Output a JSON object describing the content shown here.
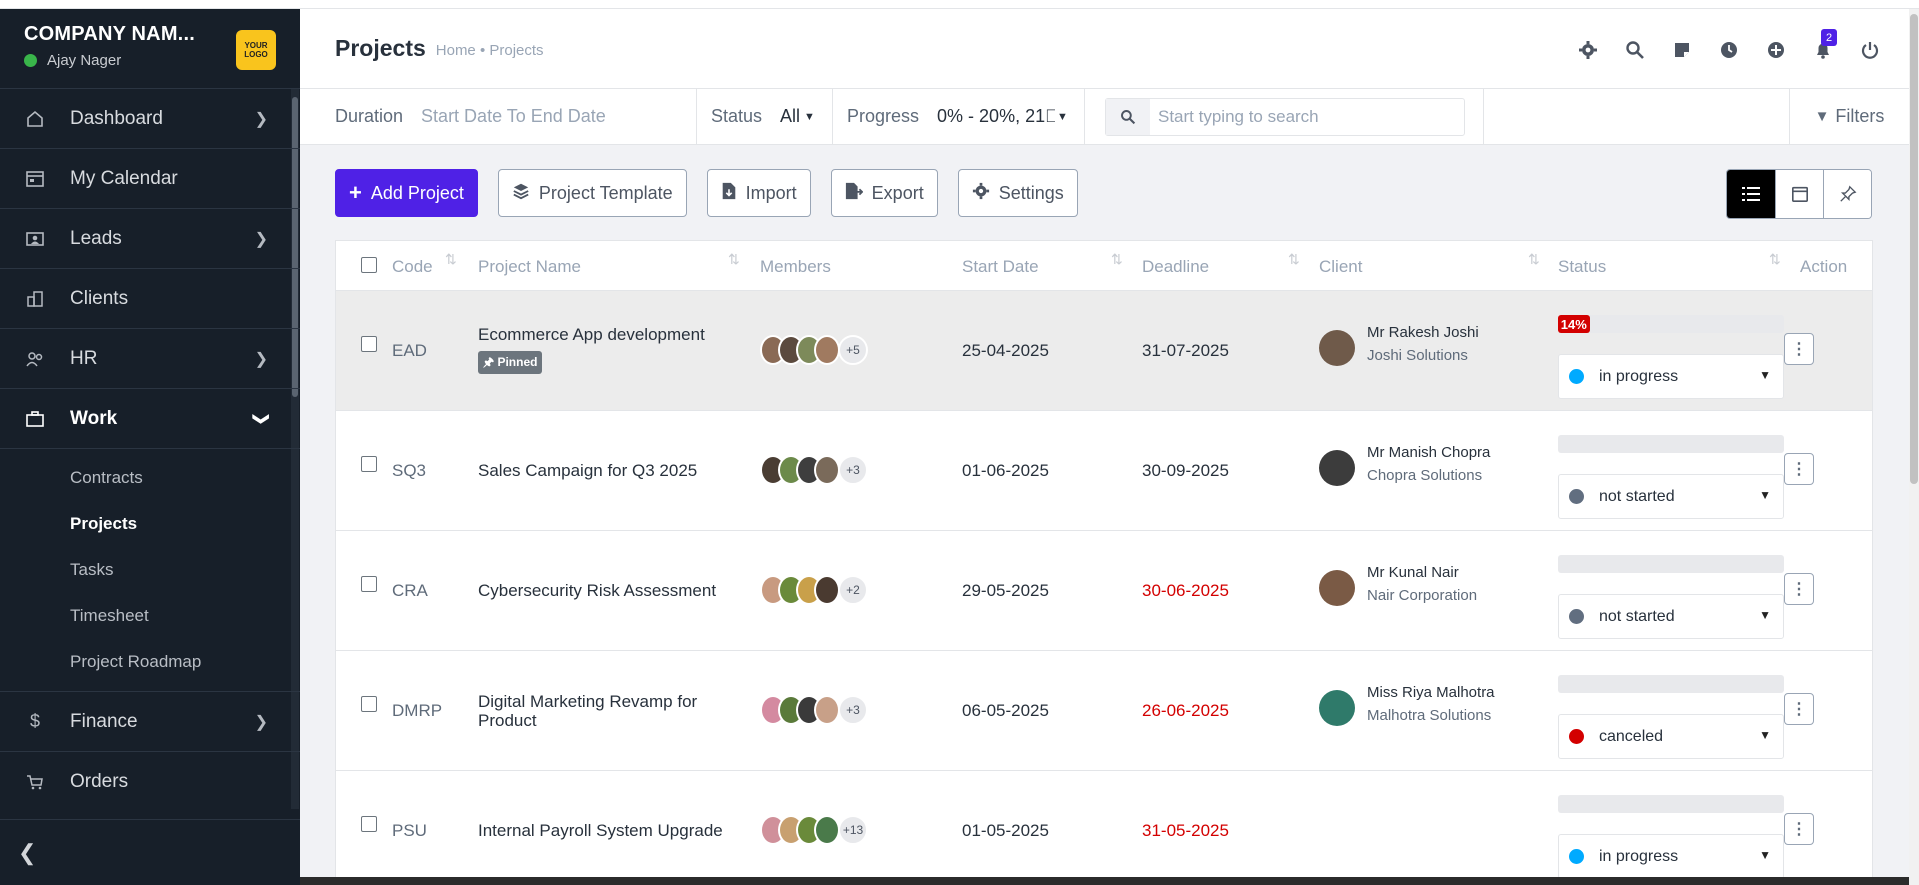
{
  "brand": {
    "company": "COMPANY NAM...",
    "user": "Ajay Nager",
    "logo_text": "YOUR LOGO"
  },
  "sidebar": {
    "items": [
      {
        "label": "Dashboard",
        "icon": "home-icon"
      },
      {
        "label": "My Calendar",
        "icon": "calendar-icon"
      },
      {
        "label": "Leads",
        "icon": "contact-card-icon"
      },
      {
        "label": "Clients",
        "icon": "building-icon"
      },
      {
        "label": "HR",
        "icon": "people-icon"
      },
      {
        "label": "Work",
        "icon": "briefcase-icon"
      },
      {
        "label": "Finance",
        "icon": "dollar-icon"
      },
      {
        "label": "Orders",
        "icon": "cart-icon"
      }
    ],
    "work_sub": [
      "Contracts",
      "Projects",
      "Tasks",
      "Timesheet",
      "Project Roadmap"
    ]
  },
  "header": {
    "title": "Projects",
    "breadcrumb": "Home • Projects",
    "notification_count": "2"
  },
  "filters": {
    "duration_label": "Duration",
    "duration_value": "Start Date To End Date",
    "status_label": "Status",
    "status_value": "All",
    "progress_label": "Progress",
    "progress_value": "0% - 20%, 21\u0000",
    "search_placeholder": "Start typing to search",
    "filters_label": "Filters"
  },
  "toolbar": {
    "add_project": "Add Project",
    "project_template": "Project Template",
    "import": "Import",
    "export": "Export",
    "settings": "Settings"
  },
  "table": {
    "columns": [
      "Code",
      "Project Name",
      "Members",
      "Start Date",
      "Deadline",
      "Client",
      "Status",
      "Action"
    ],
    "rows": [
      {
        "code": "EAD",
        "name": "Ecommerce App development",
        "pinned": "Pinned",
        "more": "+5",
        "start": "25-04-2025",
        "deadline": "31-07-2025",
        "overdue": false,
        "client_name": "Mr Rakesh Joshi",
        "client_company": "Joshi Solutions",
        "progress": "14%",
        "status": "in progress",
        "status_color": "#00aaff"
      },
      {
        "code": "SQ3",
        "name": "Sales Campaign for Q3 2025",
        "more": "+3",
        "start": "01-06-2025",
        "deadline": "30-09-2025",
        "overdue": false,
        "client_name": "Mr Manish Chopra",
        "client_company": "Chopra Solutions",
        "status": "not started",
        "status_color": "#616e80"
      },
      {
        "code": "CRA",
        "name": "Cybersecurity Risk Assessment",
        "more": "+2",
        "start": "29-05-2025",
        "deadline": "30-06-2025",
        "overdue": true,
        "client_name": "Mr Kunal Nair",
        "client_company": "Nair Corporation",
        "status": "not started",
        "status_color": "#616e80"
      },
      {
        "code": "DMRP",
        "name": "Digital Marketing Revamp for Product",
        "more": "+3",
        "start": "06-05-2025",
        "deadline": "26-06-2025",
        "overdue": true,
        "client_name": "Miss Riya Malhotra",
        "client_company": "Malhotra Solutions",
        "status": "canceled",
        "status_color": "#d30000"
      },
      {
        "code": "PSU",
        "name": "Internal Payroll System Upgrade",
        "more": "+13",
        "start": "01-05-2025",
        "deadline": "31-05-2025",
        "overdue": true,
        "client_name": "",
        "client_company": "",
        "status": "in progress",
        "status_color": "#00aaff"
      }
    ]
  }
}
